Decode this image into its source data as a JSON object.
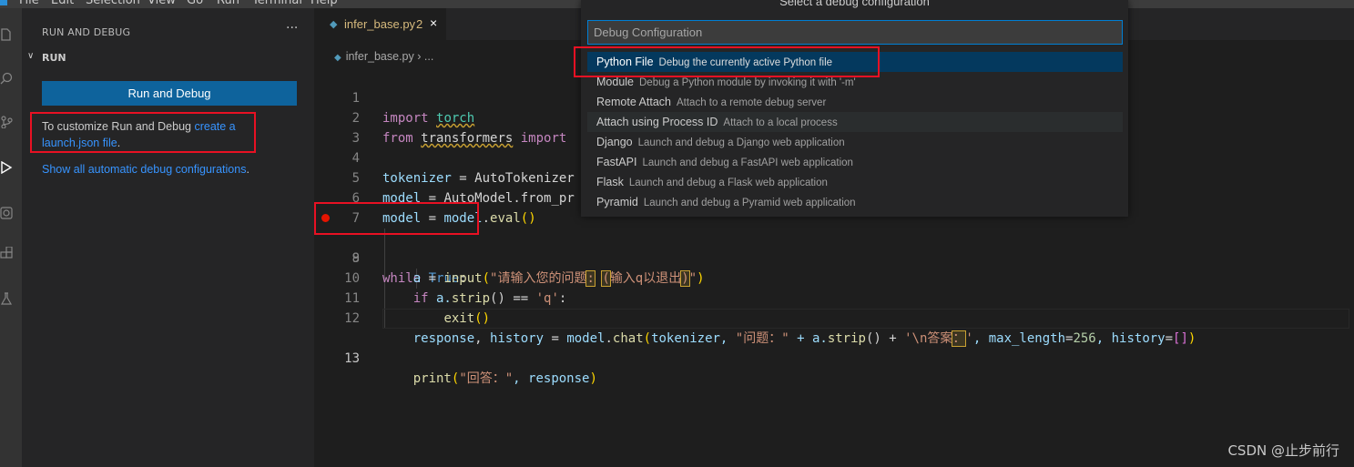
{
  "menu": [
    "File",
    "Edit",
    "Selection",
    "View",
    "Go",
    "Run",
    "Terminal",
    "Help"
  ],
  "sidebar": {
    "title": "RUN AND DEBUG",
    "more": "···",
    "section": "RUN",
    "run_button": "Run and Debug",
    "customize_text": "To customize Run and Debug ",
    "customize_link": "create a launch.json file",
    "customize_end": ".",
    "show_all_link": "Show all automatic debug configurations",
    "show_all_end": "."
  },
  "tab": {
    "name": "infer_base.py",
    "badge": "2",
    "close": "×"
  },
  "breadcrumb": {
    "file": "infer_base.py",
    "sep": "›",
    "more": "..."
  },
  "code": {
    "line_numbers": [
      "1",
      "2",
      "3",
      "4",
      "5",
      "6",
      "7",
      "8",
      "9",
      "10",
      "11",
      "12",
      "13"
    ],
    "l1_import": "import",
    "l1_mod": "torch",
    "l2_from": "from",
    "l2_mod": "transformers",
    "l2_import": "import",
    "l4_a": "tokenizer",
    "l4_b": " = ",
    "l4_c": "AutoTokenizer",
    "l5_a": "model",
    "l5_b": " = ",
    "l5_c": "AutoModel",
    "l5_d": ".from_pr",
    "l6_a": "model",
    "l6_b": " = ",
    "l6_c": "model",
    "l6_d": ".",
    "l6_e": "eval",
    "l6_f": "()",
    "l8_while": "while",
    "l8_true": "True",
    "l8_colon": ":",
    "l9_a": "a",
    "l9_b": " = ",
    "l9_fn": "input",
    "l9_p": "(",
    "l9_s1": "\"请输入您的问题",
    "l9_h1": ":",
    "l9_s2": " ",
    "l9_h2": "(",
    "l9_s3": "输入q以退出",
    "l9_h3": ")",
    "l9_s4": "\"",
    "l9_pe": ")",
    "l10_if": "if",
    "l10_a": " a.",
    "l10_fn": "strip",
    "l10_b": "() == ",
    "l10_s": "'q'",
    "l10_c": ":",
    "l11_fn": "exit",
    "l11_p": "()",
    "l12_a": "response",
    "l12_b": ", ",
    "l12_c": "history",
    "l12_d": " = ",
    "l12_e": "model",
    "l12_f": ".",
    "l12_fn": "chat",
    "l12_p": "(",
    "l12_g": "tokenizer, ",
    "l12_s1": "\"问题：\"",
    "l12_h": " + a.",
    "l12_fn2": "strip",
    "l12_i": "() + ",
    "l12_s2": "'\\n答案",
    "l12_hl": "：",
    "l12_s3": "'",
    "l12_j": ", max_length",
    "l12_k": "=",
    "l12_num": "256",
    "l12_l": ", history",
    "l12_m": "=",
    "l12_br": "[]",
    "l12_pe": ")",
    "l13_fn": "print",
    "l13_p": "(",
    "l13_s": "\"回答：\"",
    "l13_a": ", response",
    "l13_pe": ")"
  },
  "quickpick": {
    "title": "Select a debug configuration",
    "placeholder": "Debug Configuration",
    "items": [
      {
        "label": "Python File",
        "desc": "Debug the currently active Python file"
      },
      {
        "label": "Module",
        "desc": "Debug a Python module by invoking it with '-m'"
      },
      {
        "label": "Remote Attach",
        "desc": "Attach to a remote debug server"
      },
      {
        "label": "Attach using Process ID",
        "desc": "Attach to a local process"
      },
      {
        "label": "Django",
        "desc": "Launch and debug a Django web application"
      },
      {
        "label": "FastAPI",
        "desc": "Launch and debug a FastAPI web application"
      },
      {
        "label": "Flask",
        "desc": "Launch and debug a Flask web application"
      },
      {
        "label": "Pyramid",
        "desc": "Launch and debug a Pyramid web application"
      }
    ]
  },
  "watermark": "CSDN @止步前行",
  "colors": {
    "accent": "#0e639c",
    "highlight_box": "#e81123",
    "breakpoint": "#e51400"
  }
}
